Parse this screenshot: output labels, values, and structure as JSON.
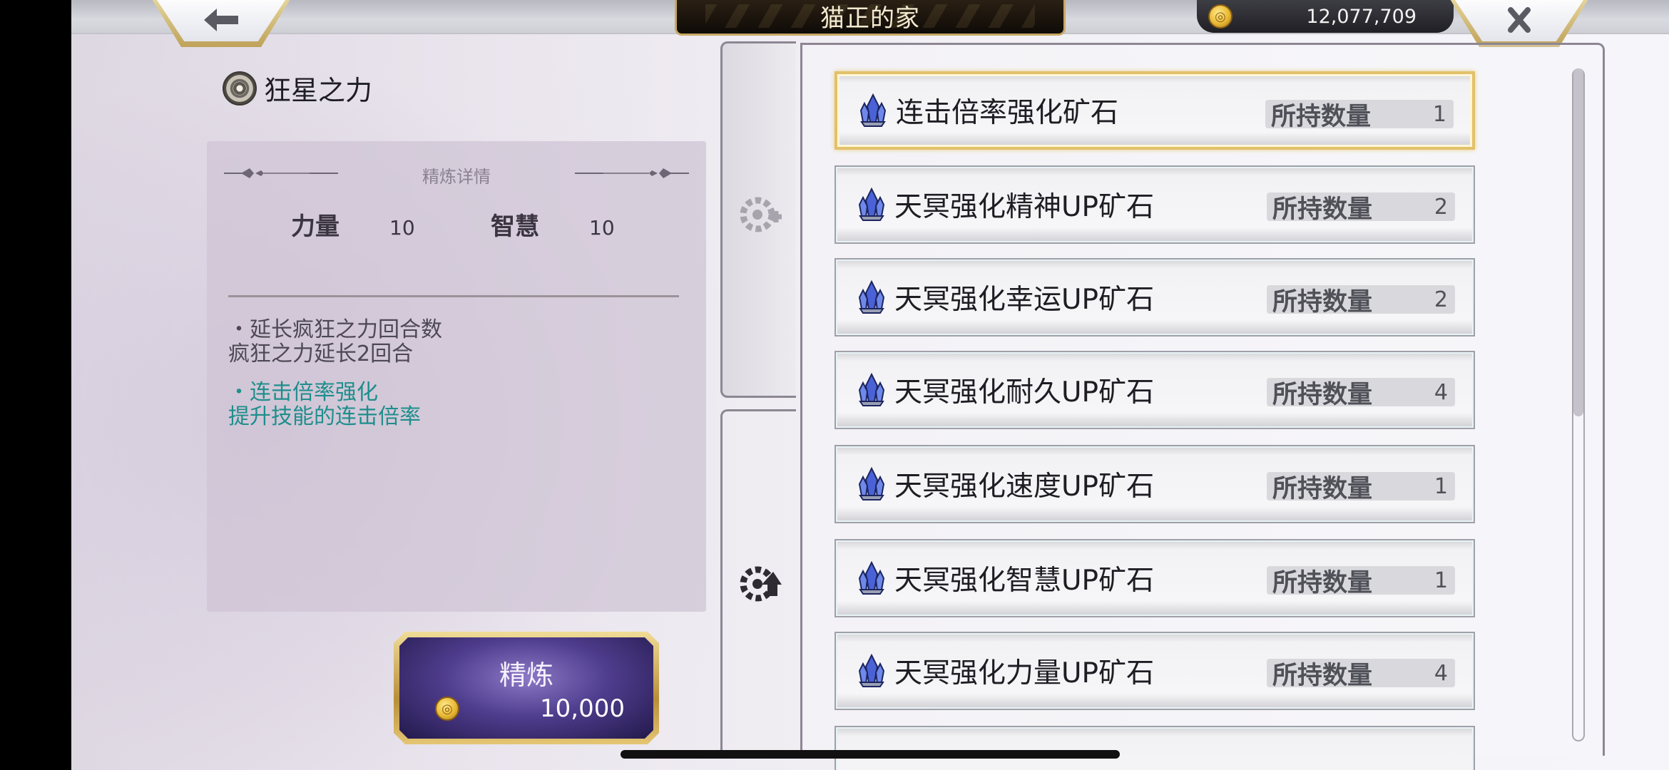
{
  "header": {
    "title": "猫正的家",
    "currency_value": "12,077,709",
    "back_icon": "arrow-left-icon",
    "close_icon": "close-x-icon",
    "coin_icon": "gold-coin-icon"
  },
  "skill": {
    "name": "狂星之力",
    "emblem_icon": "mad-star-emblem-icon"
  },
  "detail": {
    "heading": "精炼详情",
    "stats": [
      {
        "label": "力量",
        "value": "10"
      },
      {
        "label": "智慧",
        "value": "10"
      }
    ],
    "effects": [
      {
        "lines": [
          "・延长疯狂之力回合数",
          "疯狂之力延长2回合"
        ],
        "color": "#4d4854"
      },
      {
        "lines": [
          "・连击倍率强化",
          "提升技能的连击倍率"
        ],
        "color": "#1e8e8c"
      }
    ]
  },
  "refine_button": {
    "label": "精炼",
    "cost": "10,000"
  },
  "tabs": [
    {
      "icon": "gear-plus-icon"
    },
    {
      "icon": "gear-arrow-up-icon"
    }
  ],
  "items": [
    {
      "name": "连击倍率强化矿石",
      "qty_label": "所持数量",
      "qty": "1",
      "selected": true
    },
    {
      "name": "天冥强化精神UP矿石",
      "qty_label": "所持数量",
      "qty": "2",
      "selected": false
    },
    {
      "name": "天冥强化幸运UP矿石",
      "qty_label": "所持数量",
      "qty": "2",
      "selected": false
    },
    {
      "name": "天冥强化耐久UP矿石",
      "qty_label": "所持数量",
      "qty": "4",
      "selected": false
    },
    {
      "name": "天冥强化速度UP矿石",
      "qty_label": "所持数量",
      "qty": "1",
      "selected": false
    },
    {
      "name": "天冥强化智慧UP矿石",
      "qty_label": "所持数量",
      "qty": "1",
      "selected": false
    },
    {
      "name": "天冥强化力量UP矿石",
      "qty_label": "所持数量",
      "qty": "4",
      "selected": false
    }
  ],
  "colors": {
    "accent_gold": "#e2c16a",
    "effect_teal": "#1e8e8c"
  }
}
